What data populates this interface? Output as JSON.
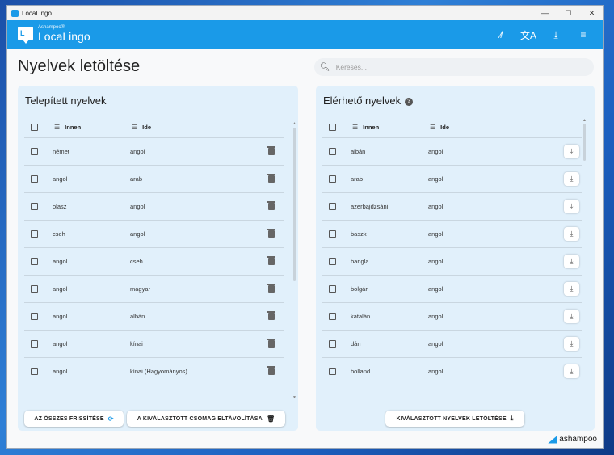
{
  "window": {
    "title": "LocaLingo",
    "min": "—",
    "max": "☐",
    "close": "✕"
  },
  "appbar": {
    "brand_small": "Ashampoo®",
    "brand": "LocaLingo",
    "logo_glyph": "L",
    "icons": [
      "magic-wand-off-icon",
      "translate-icon",
      "download-icon",
      "menu-icon"
    ],
    "accent": "#1a9ae8"
  },
  "page": {
    "title": "Nyelvek letöltése",
    "search_placeholder": "Keresés..."
  },
  "installed": {
    "title": "Telepített nyelvek",
    "columns": {
      "from": "Innen",
      "to": "Ide"
    },
    "rows": [
      {
        "from": "német",
        "to": "angol"
      },
      {
        "from": "angol",
        "to": "arab"
      },
      {
        "from": "olasz",
        "to": "angol"
      },
      {
        "from": "cseh",
        "to": "angol"
      },
      {
        "from": "angol",
        "to": "cseh"
      },
      {
        "from": "angol",
        "to": "magyar"
      },
      {
        "from": "angol",
        "to": "albán"
      },
      {
        "from": "angol",
        "to": "kínai"
      },
      {
        "from": "angol",
        "to": "kínai (Hagyományos)"
      }
    ],
    "btn_refresh": "AZ ÖSSZES FRISSÍTÉSE",
    "btn_remove": "A KIVÁLASZTOTT CSOMAG ELTÁVOLÍTÁSA"
  },
  "available": {
    "title": "Elérhető nyelvek",
    "help_glyph": "?",
    "columns": {
      "from": "Innen",
      "to": "Ide"
    },
    "rows": [
      {
        "from": "albán",
        "to": "angol"
      },
      {
        "from": "arab",
        "to": "angol"
      },
      {
        "from": "azerbajdzsáni",
        "to": "angol"
      },
      {
        "from": "baszk",
        "to": "angol"
      },
      {
        "from": "bangla",
        "to": "angol"
      },
      {
        "from": "bolgár",
        "to": "angol"
      },
      {
        "from": "katalán",
        "to": "angol"
      },
      {
        "from": "dán",
        "to": "angol"
      },
      {
        "from": "holland",
        "to": "angol"
      }
    ],
    "btn_download": "KIVÁLASZTOTT NYELVEK LETÖLTÉSE"
  },
  "footer": {
    "brand": "ashampoo"
  }
}
